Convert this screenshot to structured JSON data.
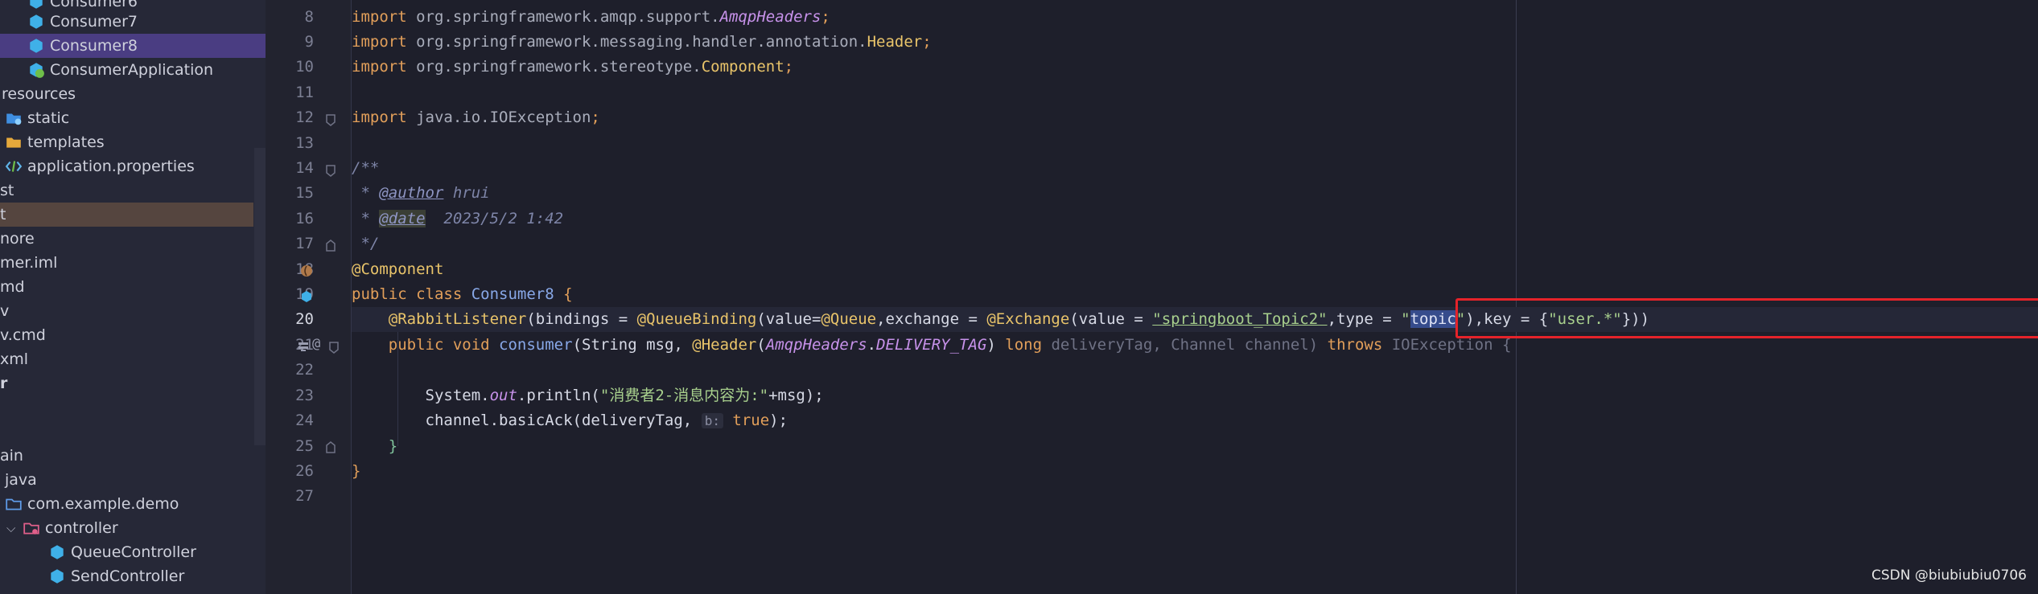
{
  "tree": {
    "items": [
      {
        "label": "Consumer6",
        "icon": "class-icon"
      },
      {
        "label": "Consumer7",
        "icon": "class-icon"
      },
      {
        "label": "Consumer8",
        "icon": "class-icon"
      },
      {
        "label": "ConsumerApplication",
        "icon": "spring-class-icon"
      },
      {
        "label": "resources",
        "icon": "none"
      },
      {
        "label": "static",
        "icon": "folder-icon"
      },
      {
        "label": "templates",
        "icon": "folder-icon"
      },
      {
        "label": "application.properties",
        "icon": "properties-icon"
      },
      {
        "label": "st",
        "icon": "none"
      },
      {
        "label": "t",
        "icon": "none"
      },
      {
        "label": "nore",
        "icon": "none"
      },
      {
        "label": "mer.iml",
        "icon": "none"
      },
      {
        "label": "md",
        "icon": "none"
      },
      {
        "label": "v",
        "icon": "none"
      },
      {
        "label": "v.cmd",
        "icon": "none"
      },
      {
        "label": "xml",
        "icon": "none"
      },
      {
        "label": "r",
        "icon": "none"
      },
      {
        "label": "",
        "icon": "none"
      },
      {
        "label": "",
        "icon": "none"
      },
      {
        "label": "ain",
        "icon": "none"
      },
      {
        "label": "java",
        "icon": "none"
      },
      {
        "label": "com.example.demo",
        "icon": "package-icon"
      },
      {
        "label": "controller",
        "icon": "package-icon"
      },
      {
        "label": "QueueController",
        "icon": "class-icon"
      },
      {
        "label": "SendController",
        "icon": "class-icon"
      }
    ]
  },
  "editor": {
    "line_numbers": [
      "8",
      "9",
      "10",
      "11",
      "12",
      "13",
      "14",
      "15",
      "16",
      "17",
      "18",
      "19",
      "20",
      "21",
      "22",
      "23",
      "24",
      "25",
      "26",
      "27"
    ],
    "l8": {
      "kw": "import",
      "pkg": " org.springframework.amqp.support.",
      "cls": "AmqpHeaders",
      "end": ";"
    },
    "l9": {
      "kw": "import",
      "pkg": " org.springframework.messaging.handler.annotation.",
      "cls": "Header",
      "end": ";"
    },
    "l10": {
      "kw": "import",
      "pkg": " org.springframework.stereotype.",
      "cls": "Component",
      "end": ";"
    },
    "l12": {
      "kw": "import",
      "pkg": " java.io.IOException",
      "end": ";"
    },
    "l14": {
      "text": "/**"
    },
    "l15": {
      "star": " * ",
      "tag": "@author",
      "rest": " hrui"
    },
    "l16": {
      "star": " * ",
      "tag": "@date",
      "rest": "  2023/5/2 1:42"
    },
    "l17": {
      "text": " */"
    },
    "l18": {
      "ann": "@Component"
    },
    "l19": {
      "kw": "public class ",
      "name": "Consumer8",
      "brace": " {"
    },
    "l20": {
      "indent": "    ",
      "ann": "@RabbitListener",
      "p1": "(bindings = ",
      "ann2": "@QueueBinding",
      "p2": "(value=",
      "ann3": "@Queue",
      "p3": ",exchange = ",
      "ann4": "@Exchange",
      "p4": "(value = ",
      "s1": "\"springboot_Topic2\"",
      "p5": ",type = ",
      "q1": "\"",
      "s2": "topic",
      "q2": "\"",
      "p6": "),key = {",
      "s3": "\"user.*\"",
      "p7": "}))"
    },
    "l21": {
      "indent": "    ",
      "kw": "public void ",
      "fn": "consumer",
      "p1": "(String msg, ",
      "ann": "@Header",
      "p2": "(",
      "cls": "AmqpHeaders",
      "dot": ".",
      "field": "DELIVERY_TAG",
      "p3": ") ",
      "kw2": "long",
      "p4": " deliveryTag, Channel channel) ",
      "kw3": "throws",
      "p5": " IOException {"
    },
    "l23": {
      "indent": "        ",
      "a": "System.",
      "field": "out",
      "b": ".println(",
      "str": "\"消费者2-消息内容为:\"",
      "c": "+msg);"
    },
    "l24": {
      "indent": "        ",
      "a": "channel.basicAck(deliveryTag, ",
      "hint": "b:",
      "kw": " true",
      "b": ");"
    },
    "l25": {
      "text": "    }"
    },
    "l26": {
      "text": "}"
    }
  },
  "watermark": "CSDN @biubiubiu0706",
  "colors": {
    "keyword": "#e29f5a",
    "string": "#a8d08d",
    "annotation": "#e9c46a",
    "highlight_box": "#e5232a"
  }
}
